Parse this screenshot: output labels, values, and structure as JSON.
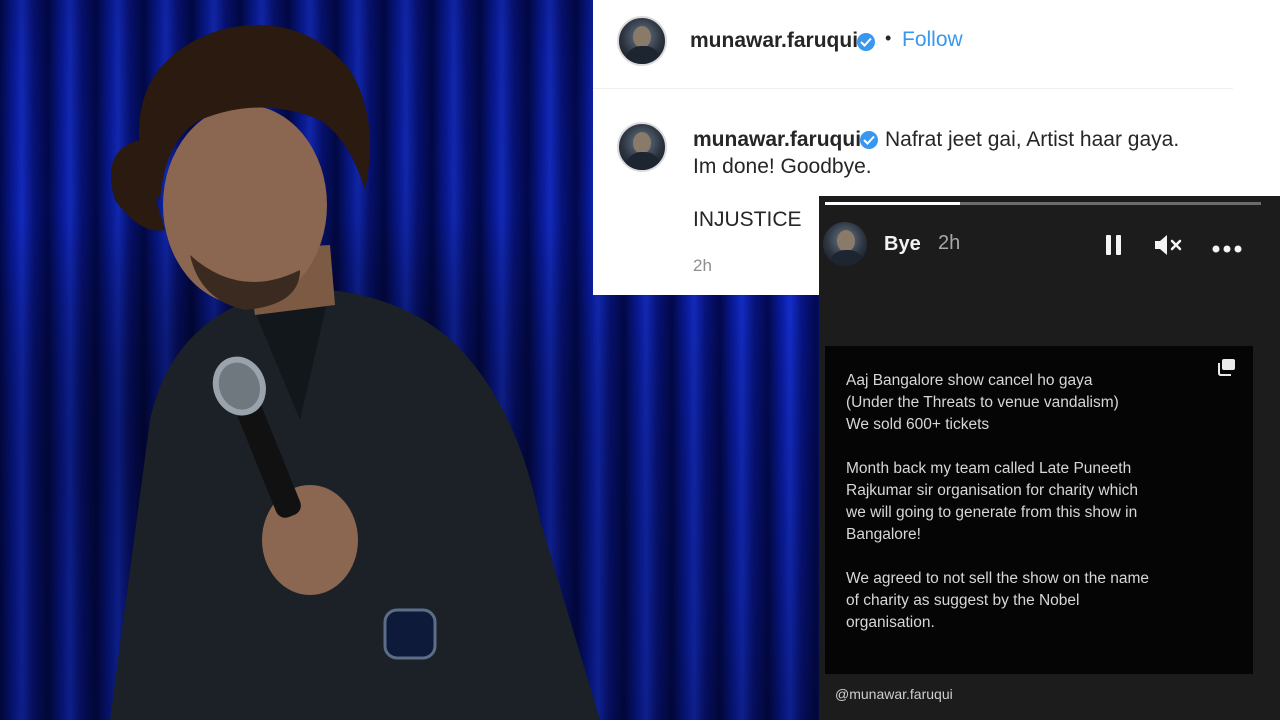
{
  "post_header": {
    "username": "munawar.faruqui",
    "separator": "•",
    "follow_label": "Follow"
  },
  "caption": {
    "username": "munawar.faruqui",
    "line1": "Nafrat jeet gai, Artist haar gaya.",
    "line2": "Im done! Goodbye.",
    "line3": "INJUSTICE",
    "time": "2h"
  },
  "story": {
    "username": "Bye",
    "time": "2h",
    "progress": 0.31,
    "icons": {
      "pause": "pause-icon",
      "mute": "muted-speaker-icon",
      "more": "more-horizontal-icon",
      "copy": "copy-icon"
    },
    "paragraphs": [
      "Aaj Bangalore show cancel ho gaya\n(Under the Threats to venue vandalism)\nWe sold 600+ tickets",
      "Month back my team called Late Puneeth\nRajkumar sir organisation for charity which\nwe will going to generate from this show in\nBangalore!",
      "We agreed to not sell the show on the name\nof charity as suggest by the Nobel\norganisation."
    ],
    "handle": "@munawar.faruqui"
  },
  "colors": {
    "instagram_blue": "#3897f0",
    "text_primary": "#262626",
    "text_secondary": "#8e8e8e",
    "story_bg": "#1c1c1c",
    "curtain_blue": "#1530d8"
  }
}
